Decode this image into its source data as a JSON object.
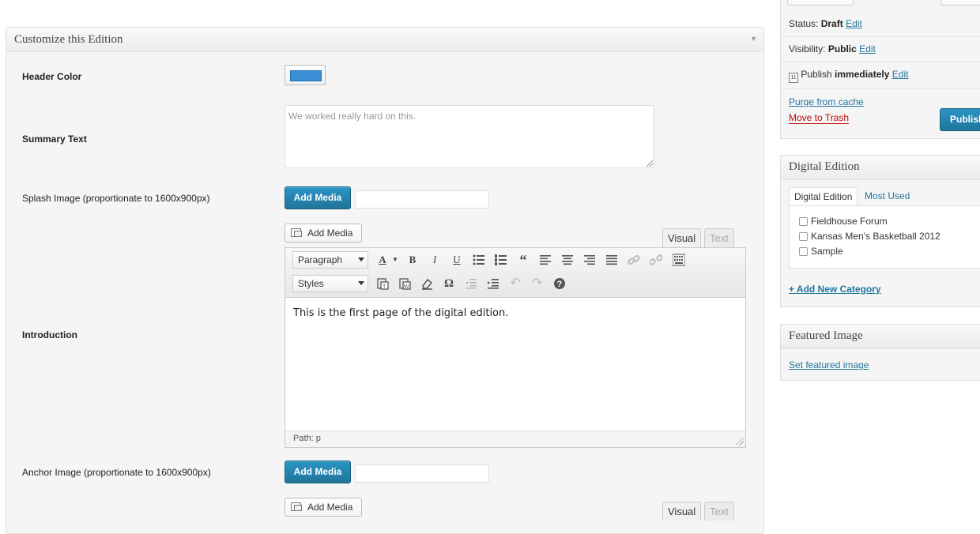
{
  "metabox": {
    "title": "Customize this Edition",
    "fields": {
      "header_color": {
        "label": "Header Color",
        "value": "#3a8fd4"
      },
      "summary_text": {
        "label": "Summary Text",
        "placeholder": "We worked really hard on this."
      },
      "splash_image": {
        "label": "Splash Image (proportionate to 1600x900px)",
        "button": "Add Media"
      },
      "introduction": {
        "label": "Introduction"
      },
      "anchor_image": {
        "label": "Anchor Image (proportionate to 1600x900px)",
        "button": "Add Media"
      }
    },
    "editor": {
      "add_media": "Add Media",
      "tab_visual": "Visual",
      "tab_text": "Text",
      "format_select": "Paragraph",
      "styles_select": "Styles",
      "content": "This is the first page of the digital edition.",
      "path": "Path: p"
    },
    "editor2": {
      "add_media": "Add Media",
      "tab_visual": "Visual",
      "tab_text": "Text"
    }
  },
  "publish": {
    "status_label": "Status:",
    "status_value": "Draft",
    "visibility_label": "Visibility:",
    "visibility_value": "Public",
    "publish_label": "Publish",
    "publish_value": "immediately",
    "edit": "Edit",
    "purge": "Purge from cache",
    "trash": "Move to Trash",
    "publish_button": "Publish"
  },
  "digital_edition": {
    "title": "Digital Edition",
    "tabs": [
      "Digital Edition",
      "Most Used"
    ],
    "items": [
      "Fieldhouse Forum",
      "Kansas Men's Basketball 2012",
      "Sample"
    ],
    "add_new": "+ Add New Category"
  },
  "featured_image": {
    "title": "Featured Image",
    "link": "Set featured image"
  },
  "colors": {
    "primary": "#21759b",
    "trash": "#bc0b0b"
  }
}
